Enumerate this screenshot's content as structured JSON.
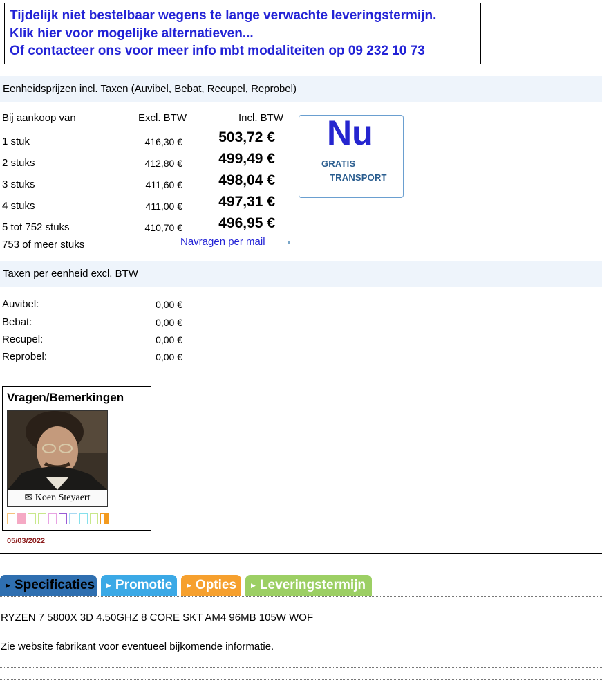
{
  "notice": {
    "line1": "Tijdelijk niet bestelbaar wegens te lange verwachte leveringstermijn.",
    "line2": "Klik hier voor mogelijke alternatieven...",
    "line3": "Of contacteer ons voor meer info mbt modaliteiten op 09 232 10 73"
  },
  "prices": {
    "band_title": "Eenheidsprijzen incl. Taxen (Auvibel, Bebat, Recupel, Reprobel)",
    "col_qty": "Bij aankoop van",
    "col_excl": "Excl. BTW",
    "col_incl": "Incl. BTW",
    "rows": [
      {
        "qty": "1 stuk",
        "excl": "416,30 €",
        "incl": "503,72 €"
      },
      {
        "qty": "2 stuks",
        "excl": "412,80 €",
        "incl": "499,49 €"
      },
      {
        "qty": "3 stuks",
        "excl": "411,60 €",
        "incl": "498,04 €"
      },
      {
        "qty": "4 stuks",
        "excl": "411,00 €",
        "incl": "497,31 €"
      },
      {
        "qty": "5 tot 752 stuks",
        "excl": "410,70 €",
        "incl": "496,95 €"
      }
    ],
    "last_qty": "753 of meer stuks",
    "mail_link": "Navragen per mail"
  },
  "badge": {
    "big": "Nu",
    "line1": "GRATIS",
    "line2": "TRANSPORT"
  },
  "taxes": {
    "band_title": "Taxen per eenheid excl. BTW",
    "rows": [
      {
        "label": "Auvibel:",
        "value": "0,00 €"
      },
      {
        "label": "Bebat:",
        "value": "0,00 €"
      },
      {
        "label": "Recupel:",
        "value": "0,00 €"
      },
      {
        "label": "Reprobel:",
        "value": "0,00 €"
      }
    ]
  },
  "contact": {
    "title": "Vragen/Bemerkingen",
    "name": "Koen Steyaert",
    "date": "05/03/2022",
    "swatches": [
      "#f4c27a",
      "#f5a9c4",
      "#c8e88a",
      "#c8e88a",
      "#e7a3e3",
      "#9a5bd6",
      "#a9d8f2",
      "#86e0ec",
      "#c8e88a",
      "#f39a1e"
    ]
  },
  "tabs": [
    {
      "label": "Specificaties",
      "color": "#2f6fb0"
    },
    {
      "label": "Promotie",
      "color": "#3ba9e6"
    },
    {
      "label": "Opties",
      "color": "#f6a02e"
    },
    {
      "label": "Leveringstermijn",
      "color": "#9ccf64"
    }
  ],
  "spec": {
    "line1": "RYZEN 7 5800X 3D 4.50GHZ 8 CORE SKT AM4 96MB 105W WOF",
    "line2": "Zie website fabrikant voor eventueel bijkomende informatie."
  }
}
